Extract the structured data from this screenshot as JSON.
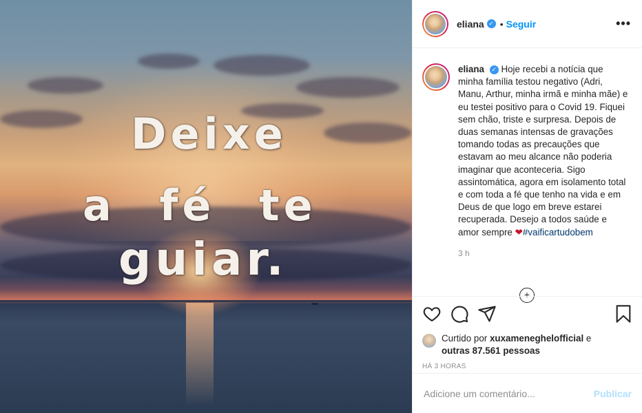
{
  "media": {
    "quote_line1": "Deixe",
    "quote_line2": "a fé te",
    "quote_line3": "guiar."
  },
  "header": {
    "username": "eliana",
    "verified_icon": "verified-badge-icon",
    "separator": "•",
    "follow_label": "Seguir",
    "more_icon": "•••"
  },
  "caption": {
    "username": "eliana",
    "text": "Hoje recebi a notícia que minha família testou negativo (Adri, Manu, Arthur, minha irmã e minha mãe) e eu testei positivo para o Covid 19. Fiquei sem chão, triste e surpresa. Depois de duas semanas intensas de gravações tomando todas as precauções que estavam ao meu alcance não poderia imaginar que aconteceria. Sigo assintomática, agora em isolamento total e com toda a fé que tenho na vida e em Deus de que logo em breve estarei recuperada. Desejo a todos saúde e amor sempre",
    "heart": "❤",
    "hashtag": "#vaificartudobem",
    "time": "3 h"
  },
  "load_more_icon": "+",
  "likes": {
    "prefix": "Curtido por",
    "liker": "xuxameneghelofficial",
    "conj": "e",
    "others": "outras 87.561 pessoas"
  },
  "posted_ago": "HÁ 3 HORAS",
  "comment_box": {
    "placeholder": "Adicione um comentário...",
    "publish_label": "Publicar"
  },
  "colors": {
    "accent": "#0095f6",
    "publish_disabled": "#b2dffc",
    "heart": "#c4142a"
  }
}
